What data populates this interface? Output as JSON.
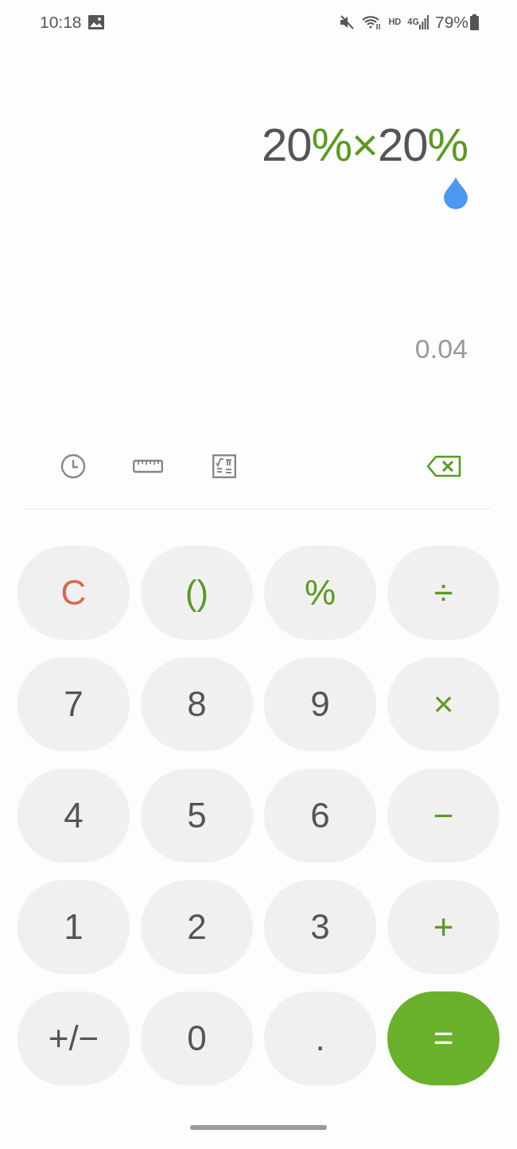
{
  "status_bar": {
    "time": "10:18",
    "network": "HD",
    "signal_type": "4G",
    "battery": "79%"
  },
  "expression": [
    {
      "kind": "number",
      "text": "20"
    },
    {
      "kind": "operator",
      "text": "%"
    },
    {
      "kind": "operator",
      "text": "×"
    },
    {
      "kind": "number",
      "text": "20"
    },
    {
      "kind": "operator",
      "text": "%"
    }
  ],
  "result": "0.04",
  "keys": [
    {
      "kind": "clear",
      "label": "C"
    },
    {
      "kind": "function",
      "label": "()"
    },
    {
      "kind": "function",
      "label": "%"
    },
    {
      "kind": "operator",
      "label": "÷"
    },
    {
      "kind": "digit",
      "label": "7"
    },
    {
      "kind": "digit",
      "label": "8"
    },
    {
      "kind": "digit",
      "label": "9"
    },
    {
      "kind": "operator",
      "label": "×"
    },
    {
      "kind": "digit",
      "label": "4"
    },
    {
      "kind": "digit",
      "label": "5"
    },
    {
      "kind": "digit",
      "label": "6"
    },
    {
      "kind": "operator",
      "label": "−"
    },
    {
      "kind": "digit",
      "label": "1"
    },
    {
      "kind": "digit",
      "label": "2"
    },
    {
      "kind": "digit",
      "label": "3"
    },
    {
      "kind": "operator",
      "label": "+"
    },
    {
      "kind": "digit",
      "label": "+/−"
    },
    {
      "kind": "digit",
      "label": "0"
    },
    {
      "kind": "digit",
      "label": "."
    },
    {
      "kind": "equals",
      "label": "="
    }
  ]
}
